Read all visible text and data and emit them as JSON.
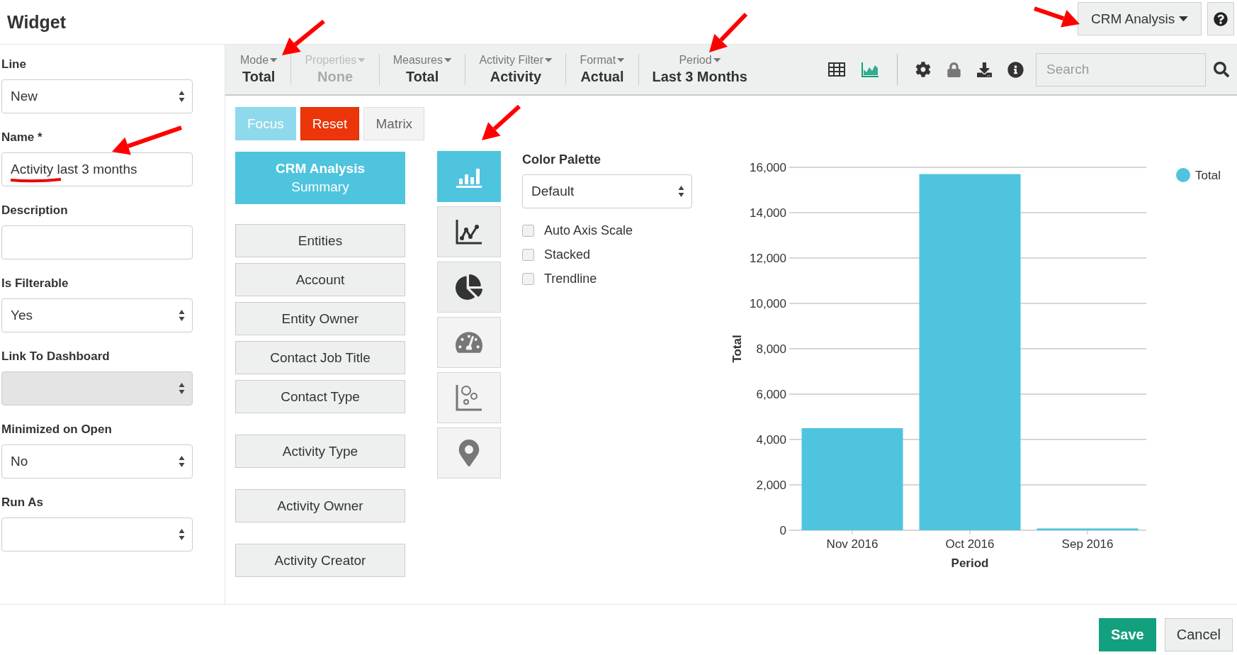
{
  "header": {
    "title": "Widget",
    "app_menu": "CRM Analysis"
  },
  "form": {
    "fields": [
      {
        "label": "Line",
        "kind": "select",
        "value": "New",
        "disabled": false
      },
      {
        "label": "Name *",
        "kind": "text",
        "value": "Activity last 3 months",
        "disabled": false
      },
      {
        "label": "Description",
        "kind": "text",
        "disabled": false
      },
      {
        "label": "Is Filterable",
        "kind": "select",
        "value": "Yes",
        "disabled": false
      },
      {
        "label": "Link To Dashboard",
        "kind": "select",
        "disabled": true
      },
      {
        "label": "Minimized on Open",
        "kind": "select",
        "value": "No",
        "disabled": false
      },
      {
        "label": "Run As",
        "kind": "select",
        "disabled": false
      }
    ]
  },
  "toolbar": {
    "items": [
      {
        "label": "Mode",
        "value": "Total",
        "disabled": false
      },
      {
        "label": "Properties",
        "value": "None",
        "disabled": true
      },
      {
        "label": "Measures",
        "value": "Total",
        "disabled": false
      },
      {
        "label": "Activity Filter",
        "value": "Activity",
        "disabled": false
      },
      {
        "label": "Format",
        "value": "Actual",
        "disabled": false
      },
      {
        "label": "Period",
        "value": "Last 3 Months",
        "disabled": false
      }
    ],
    "view_modes": [
      {
        "kind": "table",
        "selected": false
      },
      {
        "kind": "chart",
        "selected": true
      }
    ],
    "tools": [
      {
        "kind": "settings"
      },
      {
        "kind": "lock"
      },
      {
        "kind": "download"
      },
      {
        "kind": "info"
      }
    ],
    "search": {
      "placeholder": "Search"
    }
  },
  "actions": [
    {
      "label": "Focus",
      "kind": "focus"
    },
    {
      "label": "Reset",
      "kind": "reset"
    },
    {
      "label": "Matrix",
      "kind": "matrix"
    }
  ],
  "dimension_groups": [
    {
      "items": [
        {
          "title": "CRM Analysis",
          "subtitle": "Summary",
          "selected": true
        }
      ]
    },
    {
      "items": [
        {
          "title": "Entities",
          "selected": false
        },
        {
          "title": "Account",
          "selected": false
        },
        {
          "title": "Entity Owner",
          "selected": false
        },
        {
          "title": "Contact Job Title",
          "selected": false
        },
        {
          "title": "Contact Type",
          "selected": false
        }
      ]
    },
    {
      "items": [
        {
          "title": "Activity Type",
          "selected": false
        }
      ]
    },
    {
      "items": [
        {
          "title": "Activity Owner",
          "selected": false
        }
      ]
    },
    {
      "items": [
        {
          "title": "Activity Creator",
          "selected": false
        }
      ]
    }
  ],
  "chart_types": [
    {
      "kind": "bar",
      "selected": true,
      "disabled": false
    },
    {
      "kind": "line",
      "selected": false,
      "disabled": false
    },
    {
      "kind": "pie",
      "selected": false,
      "disabled": false
    },
    {
      "kind": "gauge",
      "selected": false,
      "disabled": true
    },
    {
      "kind": "scatter",
      "selected": false,
      "disabled": true
    },
    {
      "kind": "map",
      "selected": false,
      "disabled": true
    }
  ],
  "options": {
    "palette_label": "Color Palette",
    "palette": "Default",
    "checkboxes": [
      {
        "label": "Auto Axis Scale",
        "checked": false
      },
      {
        "label": "Stacked",
        "checked": false
      },
      {
        "label": "Trendline",
        "checked": false
      }
    ]
  },
  "chart": {
    "chart_data": {
      "type": "bar",
      "xlabel": "Period",
      "ylabel": "Total",
      "categories": [
        "Nov 2016",
        "Oct 2016",
        "Sep 2016"
      ],
      "series": [
        {
          "name": "Total",
          "color": "#4fc4de",
          "values": [
            4500,
            15700,
            80
          ]
        }
      ],
      "ylim": [
        0,
        16000
      ],
      "grid": true,
      "yticks": [
        {
          "value": 0,
          "label": "0"
        },
        {
          "value": 2000,
          "label": "2,000"
        },
        {
          "value": 4000,
          "label": "4,000"
        },
        {
          "value": 6000,
          "label": "6,000"
        },
        {
          "value": 8000,
          "label": "8,000"
        },
        {
          "value": 10000,
          "label": "10,000"
        },
        {
          "value": 12000,
          "label": "12,000"
        },
        {
          "value": 14000,
          "label": "14,000"
        },
        {
          "value": 16000,
          "label": "16,000"
        }
      ]
    }
  },
  "footer": {
    "buttons": [
      {
        "label": "Save",
        "kind": "primary"
      },
      {
        "label": "Cancel",
        "kind": "secondary"
      }
    ]
  }
}
